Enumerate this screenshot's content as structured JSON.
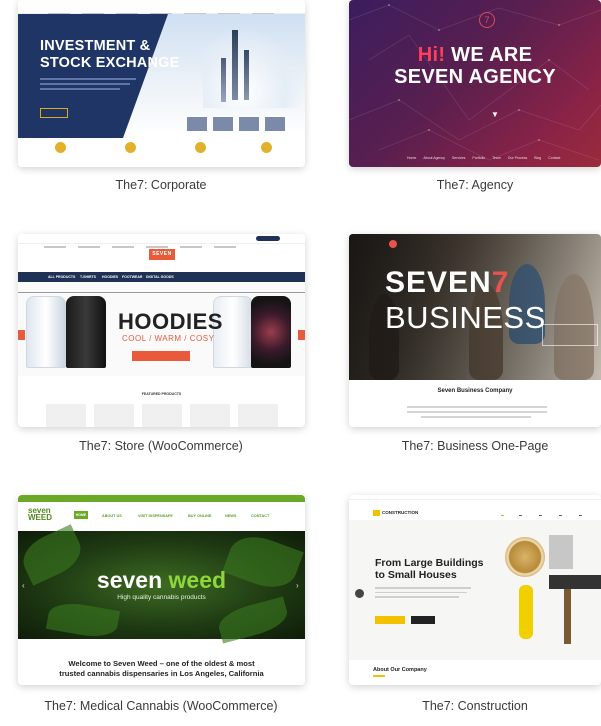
{
  "demos": [
    {
      "caption": "The7: Corporate",
      "hero_line1": "INVESTMENT &",
      "hero_line2": "STOCK EXCHANGE"
    },
    {
      "caption": "The7: Agency",
      "hero_hi": "Hi!",
      "hero_line1_rest": " WE ARE",
      "hero_line2": "SEVEN AGENCY",
      "nav": [
        "Home",
        "About Agency",
        "Services",
        "Portfolio",
        "Team",
        "Our Process",
        "Blog",
        "Contact"
      ]
    },
    {
      "caption": "The7: Store (WooCommerce)",
      "hero_title": "HOODIES",
      "hero_sub": "COOL / WARM / COSY",
      "menu": [
        "ALL PRODUCTS",
        "T-SHIRTS",
        "HOODIES",
        "FOOTWEAR",
        "DIGITAL GOODS"
      ],
      "featured": "FEATURED PRODUCTS"
    },
    {
      "caption": "The7: Business One-Page",
      "hero_seven": "SEVEN",
      "hero_seven_num": "7",
      "hero_business": "BUSINESS",
      "company": "Seven Business Company"
    },
    {
      "caption": "The7: Medical Cannabis (WooCommerce)",
      "logo_top": "seven",
      "logo_bottom": "WEED",
      "nav": [
        "HOME",
        "ABOUT US",
        "VISIT DISPENSARY",
        "BUY ONLINE",
        "NEWS",
        "CONTACT"
      ],
      "hero_seven": "seven ",
      "hero_weed": "weed",
      "hero_sub": "High quality cannabis products",
      "welcome_line1": "Welcome to Seven Weed – one of the oldest & most",
      "welcome_line2": "trusted cannabis dispensaries in Los Angeles, California"
    },
    {
      "caption": "The7: Construction",
      "logo": "CONSTRUCTION",
      "hero_line1": "From Large Buildings",
      "hero_line2": "to Small Houses",
      "about": "About Our Company"
    }
  ],
  "colors": {
    "corporate_blue": "#1e3566",
    "corporate_gold": "#e2b12b",
    "agency_red": "#ff3f5a",
    "store_orange": "#e85a3a",
    "store_navy": "#1f3155",
    "business_red": "#e8524f",
    "weed_green": "#6aa826",
    "construction_yellow": "#f2c200"
  }
}
